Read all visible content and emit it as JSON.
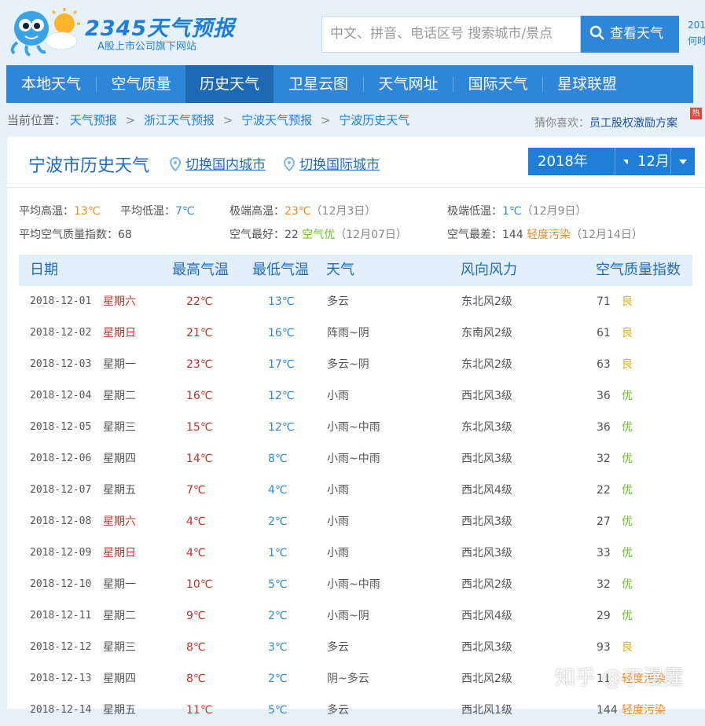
{
  "logo": {
    "title": "2345天气预报",
    "subtitle": "A股上市公司旗下网站"
  },
  "search": {
    "placeholder": "中文、拼音、电话区号  搜索城市/景点",
    "button_label": "查看天气"
  },
  "header_right": {
    "line1": "201",
    "line2": "何时"
  },
  "nav": {
    "items": [
      "本地天气",
      "空气质量",
      "历史天气",
      "卫星云图",
      "天气网址",
      "国际天气",
      "星球联盟"
    ],
    "active_index": 2
  },
  "breadcrumb": {
    "prefix": "当前位置：",
    "items": [
      "天气预报",
      "浙江天气预报",
      "宁波天气预报",
      "宁波历史天气"
    ],
    "separator": ">"
  },
  "guess": {
    "label": "猜你喜欢：",
    "link": "员工股权激励方案",
    "badge": "热"
  },
  "panel": {
    "title": "宁波市历史天气",
    "switch_domestic": "切换国内城市",
    "switch_international": "切换国际城市",
    "year": "2018年",
    "month": "12月"
  },
  "stats": {
    "avg_high_label": "平均高温：",
    "avg_high": "13℃",
    "avg_low_label": "平均低温：",
    "avg_low": "7℃",
    "ext_high_label": "极端高温：",
    "ext_high": "23℃",
    "ext_high_date": "（12月3日）",
    "ext_low_label": "极端低温：",
    "ext_low": "1℃",
    "ext_low_date": "（12月9日）",
    "avg_aqi_label": "平均空气质量指数：",
    "avg_aqi": "68",
    "best_air_label": "空气最好：",
    "best_air_value": "22",
    "best_air_level": "空气优",
    "best_air_date": "（12月07日）",
    "worst_air_label": "空气最差：",
    "worst_air_value": "144",
    "worst_air_level": "轻度污染",
    "worst_air_date": "（12月14日）"
  },
  "table": {
    "headers": [
      "日期",
      "最高气温",
      "最低气温",
      "天气",
      "风向风力",
      "空气质量指数"
    ],
    "rows": [
      {
        "date": "2018-12-01",
        "week": "星期六",
        "hi": "22℃",
        "lo": "13℃",
        "weather": "多云",
        "wind": "东北风2级",
        "aqi": "71",
        "level": "良"
      },
      {
        "date": "2018-12-02",
        "week": "星期日",
        "hi": "21℃",
        "lo": "16℃",
        "weather": "阵雨~阴",
        "wind": "东南风2级",
        "aqi": "61",
        "level": "良"
      },
      {
        "date": "2018-12-03",
        "week": "星期一",
        "hi": "23℃",
        "lo": "17℃",
        "weather": "多云~阴",
        "wind": "东北风2级",
        "aqi": "63",
        "level": "良"
      },
      {
        "date": "2018-12-04",
        "week": "星期二",
        "hi": "16℃",
        "lo": "12℃",
        "weather": "小雨",
        "wind": "西北风3级",
        "aqi": "36",
        "level": "优"
      },
      {
        "date": "2018-12-05",
        "week": "星期三",
        "hi": "15℃",
        "lo": "12℃",
        "weather": "小雨~中雨",
        "wind": "东北风3级",
        "aqi": "36",
        "level": "优"
      },
      {
        "date": "2018-12-06",
        "week": "星期四",
        "hi": "14℃",
        "lo": "8℃",
        "weather": "小雨~中雨",
        "wind": "西北风3级",
        "aqi": "32",
        "level": "优"
      },
      {
        "date": "2018-12-07",
        "week": "星期五",
        "hi": "7℃",
        "lo": "4℃",
        "weather": "小雨",
        "wind": "西北风4级",
        "aqi": "22",
        "level": "优"
      },
      {
        "date": "2018-12-08",
        "week": "星期六",
        "hi": "4℃",
        "lo": "2℃",
        "weather": "小雨",
        "wind": "西北风3级",
        "aqi": "27",
        "level": "优"
      },
      {
        "date": "2018-12-09",
        "week": "星期日",
        "hi": "4℃",
        "lo": "1℃",
        "weather": "小雨",
        "wind": "西北风3级",
        "aqi": "33",
        "level": "优"
      },
      {
        "date": "2018-12-10",
        "week": "星期一",
        "hi": "10℃",
        "lo": "5℃",
        "weather": "小雨~中雨",
        "wind": "西北风2级",
        "aqi": "32",
        "level": "优"
      },
      {
        "date": "2018-12-11",
        "week": "星期二",
        "hi": "9℃",
        "lo": "2℃",
        "weather": "小雨~阴",
        "wind": "西北风4级",
        "aqi": "29",
        "level": "优"
      },
      {
        "date": "2018-12-12",
        "week": "星期三",
        "hi": "8℃",
        "lo": "3℃",
        "weather": "多云",
        "wind": "西北风3级",
        "aqi": "93",
        "level": "良"
      },
      {
        "date": "2018-12-13",
        "week": "星期四",
        "hi": "8℃",
        "lo": "2℃",
        "weather": "阴~多云",
        "wind": "西北风2级",
        "aqi": "11",
        "level": "轻度污染"
      },
      {
        "date": "2018-12-14",
        "week": "星期五",
        "hi": "11℃",
        "lo": "5℃",
        "weather": "多云",
        "wind": "西北风1级",
        "aqi": "144",
        "level": "轻度污染"
      }
    ]
  },
  "watermark": "知乎 @丁漫霆",
  "colors": {
    "brand_blue": "#2f86d8",
    "nav_active": "#1d69b3",
    "hi_temp": "#c6302a",
    "lo_temp": "#2e8ad8",
    "level_you": "#6cbf29",
    "level_liang": "#e0b11c",
    "level_qingdu": "#f08a23"
  }
}
